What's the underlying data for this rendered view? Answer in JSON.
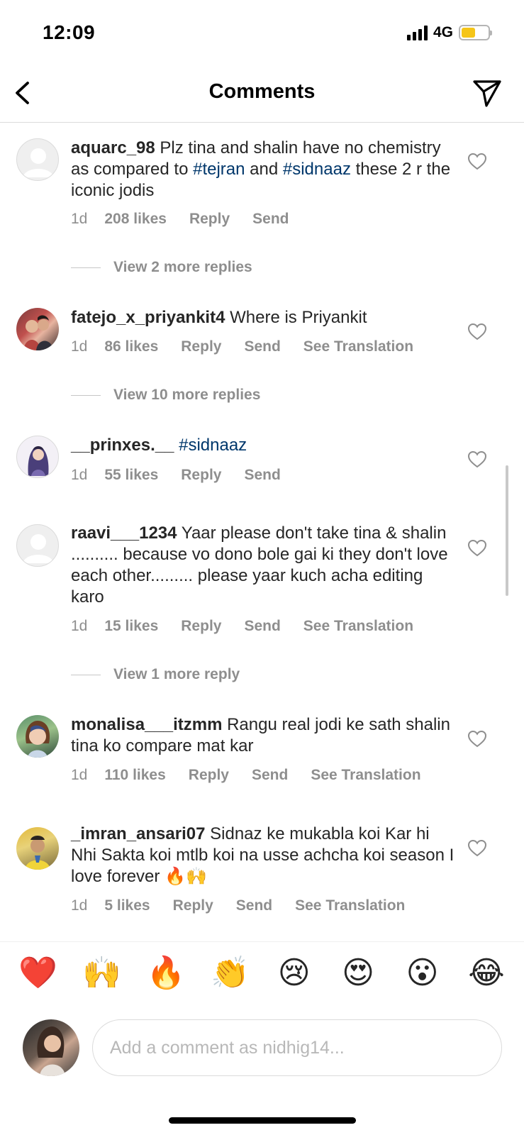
{
  "status_bar": {
    "time": "12:09",
    "network": "4G"
  },
  "header": {
    "title": "Comments"
  },
  "comments": [
    {
      "username": "aquarc_98",
      "text_parts": [
        "Plz tina and shalin have no chemistry as compared to ",
        "#tejran",
        " and ",
        "#sidnaaz",
        " these 2 r the iconic jodis"
      ],
      "age": "1d",
      "likes": "208 likes",
      "reply": "Reply",
      "send": "Send",
      "view_replies": "View 2 more replies"
    },
    {
      "username": "fatejo_x_priyankit4",
      "text": "Where is Priyankit",
      "age": "1d",
      "likes": "86 likes",
      "reply": "Reply",
      "send": "Send",
      "translation": "See Translation",
      "view_replies": "View 10 more replies"
    },
    {
      "username": "__prinxes.__",
      "hashtag": "#sidnaaz",
      "age": "1d",
      "likes": "55 likes",
      "reply": "Reply",
      "send": "Send"
    },
    {
      "username": "raavi___1234",
      "text": "Yaar please don't take tina & shalin .......... because vo dono bole gai ki they don't love each other......... please yaar kuch acha editing karo",
      "age": "1d",
      "likes": "15 likes",
      "reply": "Reply",
      "send": "Send",
      "translation": "See Translation",
      "view_replies": "View 1 more reply"
    },
    {
      "username": "monalisa___itzmm",
      "text": "Rangu real jodi ke sath shalin tina ko compare mat kar",
      "age": "1d",
      "likes": "110 likes",
      "reply": "Reply",
      "send": "Send",
      "translation": "See Translation"
    },
    {
      "username": "_imran_ansari07",
      "text": "Sidnaz ke mukabla koi Kar hi Nhi Sakta koi mtlb koi na usse achcha koi season  I love forever 🔥🙌",
      "age": "1d",
      "likes": "5 likes",
      "reply": "Reply",
      "send": "Send",
      "translation": "See Translation"
    }
  ],
  "emoji_bar": [
    "❤️",
    "🙌",
    "🔥",
    "👏",
    "😢",
    "😍",
    "😮",
    "😂"
  ],
  "compose": {
    "placeholder": "Add a comment as nidhig14..."
  },
  "colors": {
    "hashtag": "#00376b",
    "muted": "#8e8e8e",
    "text": "#262626"
  }
}
